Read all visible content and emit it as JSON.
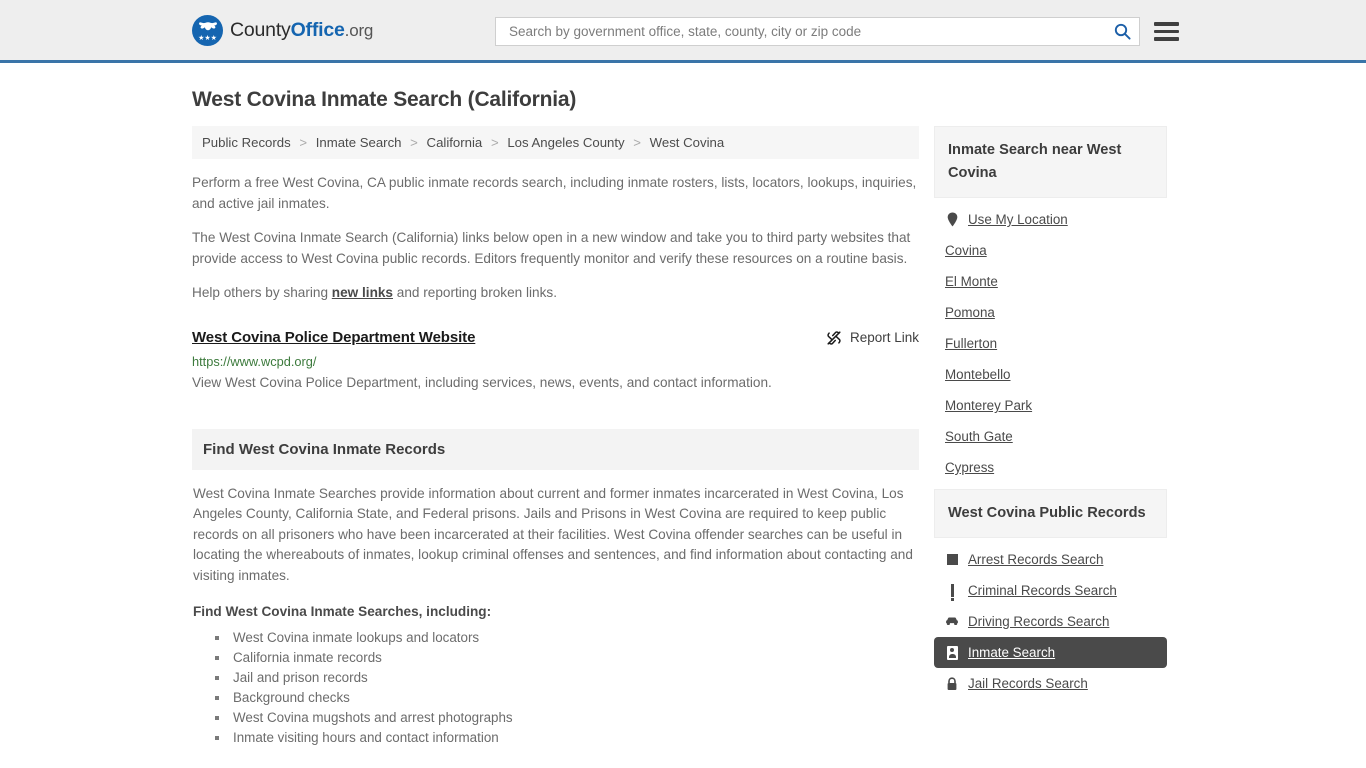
{
  "header": {
    "logo": {
      "part1": "County",
      "part2": "Office",
      "part3": ".org",
      "icon": "eagle-seal-icon"
    },
    "search": {
      "placeholder": "Search by government office, state, county, city or zip code",
      "value": "",
      "icon": "search-icon"
    },
    "menu_icon": "hamburger-menu-icon",
    "accent_color": "#3a74a8"
  },
  "page": {
    "title": "West Covina Inmate Search (California)"
  },
  "breadcrumb": {
    "items": [
      "Public Records",
      "Inmate Search",
      "California",
      "Los Angeles County",
      "West Covina"
    ],
    "separator": ">"
  },
  "main": {
    "paragraph1": "Perform a free West Covina, CA public inmate records search, including inmate rosters, lists, locators, lookups, inquiries, and active jail inmates.",
    "paragraph2": "The West Covina Inmate Search (California) links below open in a new window and take you to third party websites that provide access to West Covina public records. Editors frequently monitor and verify these resources on a routine basis.",
    "paragraph3_before": "Help others by sharing ",
    "paragraph3_link": "new links",
    "paragraph3_after": " and reporting broken links.",
    "link_entry": {
      "title": "West Covina Police Department Website",
      "report_label": "Report Link",
      "report_icon": "broken-link-icon",
      "url": "https://www.wcpd.org/",
      "description": "View West Covina Police Department, including services, news, events, and contact information."
    },
    "section": {
      "heading": "Find West Covina Inmate Records",
      "body": "West Covina Inmate Searches provide information about current and former inmates incarcerated in West Covina, Los Angeles County, California State, and Federal prisons. Jails and Prisons in West Covina are required to keep public records on all prisoners who have been incarcerated at their facilities. West Covina offender searches can be useful in locating the whereabouts of inmates, lookup criminal offenses and sentences, and find information about contacting and visiting inmates.",
      "sub_heading": "Find West Covina Inmate Searches, including:",
      "bullets": [
        "West Covina inmate lookups and locators",
        "California inmate records",
        "Jail and prison records",
        "Background checks",
        "West Covina mugshots and arrest photographs",
        "Inmate visiting hours and contact information"
      ]
    }
  },
  "sidebar": {
    "nearby": {
      "heading": "Inmate Search near West Covina",
      "use_my_location": {
        "label": "Use My Location",
        "icon": "map-pin-icon"
      },
      "cities": [
        "Covina",
        "El Monte",
        "Pomona",
        "Fullerton",
        "Montebello",
        "Monterey Park",
        "South Gate",
        "Cypress"
      ]
    },
    "public_records": {
      "heading": "West Covina Public Records",
      "items": [
        {
          "label": "Arrest Records Search",
          "icon": "fingerprint-card-icon",
          "active": false
        },
        {
          "label": "Criminal Records Search",
          "icon": "exclamation-icon",
          "active": false
        },
        {
          "label": "Driving Records Search",
          "icon": "car-icon",
          "active": false
        },
        {
          "label": "Inmate Search",
          "icon": "id-badge-icon",
          "active": true
        },
        {
          "label": "Jail Records Search",
          "icon": "lock-icon",
          "active": false
        }
      ],
      "active_bg": "#4a4a4a"
    }
  }
}
